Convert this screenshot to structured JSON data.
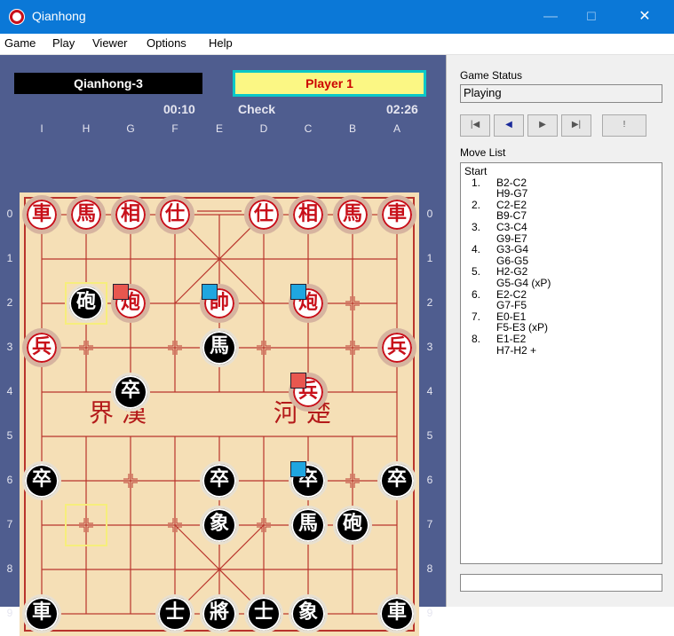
{
  "window": {
    "title": "Qianhong",
    "minimize_glyph": "—",
    "maximize_glyph": "☐",
    "close_glyph": "✕"
  },
  "menu": [
    "Game",
    "Play",
    "Viewer",
    "Options",
    "Help"
  ],
  "players": {
    "opponent": "Qianhong-3",
    "current": "Player 1"
  },
  "clock": {
    "left": "00:10",
    "check": "Check",
    "right": "02:26"
  },
  "board": {
    "columns": [
      "I",
      "H",
      "G",
      "F",
      "E",
      "D",
      "C",
      "B",
      "A"
    ],
    "rows": [
      "0",
      "1",
      "2",
      "3",
      "4",
      "5",
      "6",
      "7",
      "8",
      "9"
    ],
    "river_left": "界  漢",
    "river_right": "河  楚",
    "pieces": [
      {
        "col": 0,
        "row": 0,
        "side": "red",
        "char": "車"
      },
      {
        "col": 1,
        "row": 0,
        "side": "red",
        "char": "馬"
      },
      {
        "col": 2,
        "row": 0,
        "side": "red",
        "char": "相"
      },
      {
        "col": 3,
        "row": 0,
        "side": "red",
        "char": "仕"
      },
      {
        "col": 5,
        "row": 0,
        "side": "red",
        "char": "仕"
      },
      {
        "col": 6,
        "row": 0,
        "side": "red",
        "char": "相"
      },
      {
        "col": 7,
        "row": 0,
        "side": "red",
        "char": "馬"
      },
      {
        "col": 8,
        "row": 0,
        "side": "red",
        "char": "車"
      },
      {
        "col": 1,
        "row": 2,
        "side": "black",
        "char": "砲"
      },
      {
        "col": 2,
        "row": 2,
        "side": "red",
        "char": "炮"
      },
      {
        "col": 4,
        "row": 2,
        "side": "red",
        "char": "帥"
      },
      {
        "col": 6,
        "row": 2,
        "side": "red",
        "char": "炮"
      },
      {
        "col": 0,
        "row": 3,
        "side": "red",
        "char": "兵"
      },
      {
        "col": 4,
        "row": 3,
        "side": "black",
        "char": "馬"
      },
      {
        "col": 8,
        "row": 3,
        "side": "red",
        "char": "兵"
      },
      {
        "col": 2,
        "row": 4,
        "side": "black",
        "char": "卒"
      },
      {
        "col": 6,
        "row": 4,
        "side": "red",
        "char": "兵"
      },
      {
        "col": 0,
        "row": 6,
        "side": "black",
        "char": "卒"
      },
      {
        "col": 4,
        "row": 6,
        "side": "black",
        "char": "卒"
      },
      {
        "col": 6,
        "row": 6,
        "side": "black",
        "char": "卒"
      },
      {
        "col": 8,
        "row": 6,
        "side": "black",
        "char": "卒"
      },
      {
        "col": 4,
        "row": 7,
        "side": "black",
        "char": "象"
      },
      {
        "col": 6,
        "row": 7,
        "side": "black",
        "char": "馬"
      },
      {
        "col": 7,
        "row": 7,
        "side": "black",
        "char": "砲"
      },
      {
        "col": 0,
        "row": 9,
        "side": "black",
        "char": "車"
      },
      {
        "col": 3,
        "row": 9,
        "side": "black",
        "char": "士"
      },
      {
        "col": 4,
        "row": 9,
        "side": "black",
        "char": "將"
      },
      {
        "col": 5,
        "row": 9,
        "side": "black",
        "char": "士"
      },
      {
        "col": 6,
        "row": 9,
        "side": "black",
        "char": "象"
      },
      {
        "col": 8,
        "row": 9,
        "side": "black",
        "char": "車"
      }
    ],
    "markers": [
      {
        "col": 2,
        "row": 2,
        "color": "#e8574f"
      },
      {
        "col": 4,
        "row": 2,
        "color": "#1fa6e0"
      },
      {
        "col": 6,
        "row": 2,
        "color": "#1fa6e0"
      },
      {
        "col": 6,
        "row": 4,
        "color": "#e8574f"
      },
      {
        "col": 6,
        "row": 6,
        "color": "#1fa6e0"
      }
    ],
    "highlights": [
      {
        "col": 1,
        "row": 2
      },
      {
        "col": 1,
        "row": 7
      }
    ]
  },
  "status": {
    "label": "Game Status",
    "value": "Playing"
  },
  "nav_buttons": [
    "|◀",
    "◀",
    "▶",
    "▶|",
    "!"
  ],
  "moves": {
    "label": "Move List",
    "start": "Start",
    "list": [
      {
        "num": "1.",
        "red": "B2-C2",
        "black": "H9-G7"
      },
      {
        "num": "2.",
        "red": "C2-E2",
        "black": "B9-C7"
      },
      {
        "num": "3.",
        "red": "C3-C4",
        "black": "G9-E7"
      },
      {
        "num": "4.",
        "red": "G3-G4",
        "black": "G6-G5"
      },
      {
        "num": "5.",
        "red": "H2-G2",
        "black": "G5-G4  (xP)"
      },
      {
        "num": "6.",
        "red": "E2-C2",
        "black": "G7-F5"
      },
      {
        "num": "7.",
        "red": "E0-E1",
        "black": "F5-E3  (xP)"
      },
      {
        "num": "8.",
        "red": "E1-E2",
        "black": "H7-H2 +"
      }
    ]
  },
  "colors": {
    "titlebar": "#0b78d7",
    "panel": "#4f5d8f",
    "board": "#f5dfb6",
    "red": "#c8101a"
  }
}
